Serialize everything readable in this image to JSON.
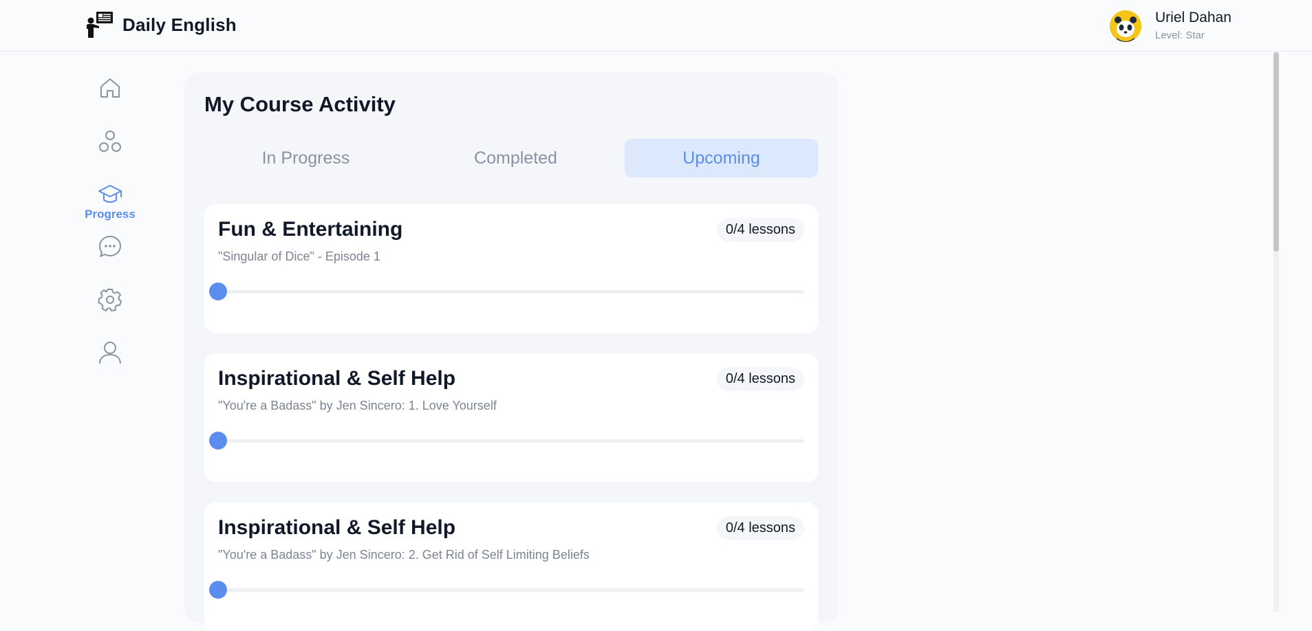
{
  "app": {
    "name": "Daily English",
    "logo_icon": "teacher-board-icon"
  },
  "user": {
    "name": "Uriel Dahan",
    "level": "Level: Star",
    "avatar_icon": "panda-avatar-icon"
  },
  "sidebar": {
    "items": [
      {
        "id": "home",
        "icon": "home-icon",
        "label": "",
        "active": false
      },
      {
        "id": "community",
        "icon": "circles-icon",
        "label": "",
        "active": false
      },
      {
        "id": "progress",
        "icon": "graduation-cap-icon",
        "label": "Progress",
        "active": true
      },
      {
        "id": "chat",
        "icon": "chat-bubble-icon",
        "label": "",
        "active": false
      },
      {
        "id": "settings",
        "icon": "gear-icon",
        "label": "",
        "active": false
      },
      {
        "id": "profile",
        "icon": "user-icon",
        "label": "",
        "active": false
      }
    ]
  },
  "main": {
    "title": "My Course Activity",
    "tabs": [
      {
        "label": "In Progress",
        "active": false
      },
      {
        "label": "Completed",
        "active": false
      },
      {
        "label": "Upcoming",
        "active": true
      }
    ],
    "courses": [
      {
        "title": "Fun & Entertaining",
        "subtitle": "\"Singular of Dice\" - Episode 1",
        "lessons": "0/4 lessons",
        "progress": 0
      },
      {
        "title": "Inspirational & Self Help",
        "subtitle": "\"You're a Badass\" by Jen Sincero: 1. Love Yourself",
        "lessons": "0/4 lessons",
        "progress": 0
      },
      {
        "title": "Inspirational & Self Help",
        "subtitle": "\"You're a Badass\" by Jen Sincero: 2. Get Rid of Self Limiting Beliefs",
        "lessons": "0/4 lessons",
        "progress": 0
      }
    ]
  },
  "colors": {
    "accent": "#5b8def",
    "accent_light": "#dce8fb",
    "muted": "#8a93a3",
    "avatar_bg": "#f5c518"
  }
}
